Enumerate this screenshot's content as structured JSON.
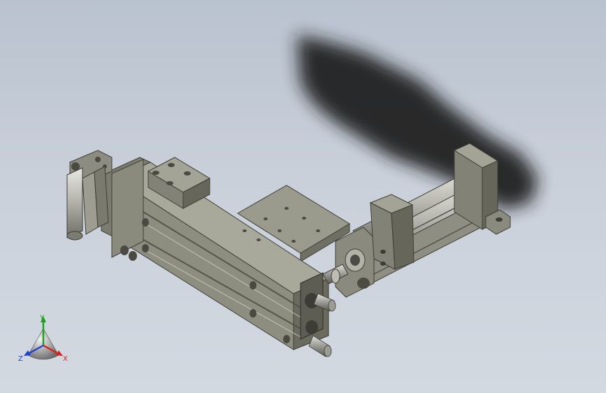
{
  "viewport": {
    "background_top": "#b9c2cf",
    "background_bottom": "#d3d9e1"
  },
  "model": {
    "body_color": "#8f8f82",
    "body_dark": "#5f5f55",
    "body_light": "#b3b3a6",
    "shadow_color": "#1e1e1e"
  },
  "triad": {
    "x_label": "X",
    "y_label": "Y",
    "z_label": "Z",
    "x_color": "#d62020",
    "y_color": "#1aa31a",
    "z_color": "#2040d0"
  }
}
